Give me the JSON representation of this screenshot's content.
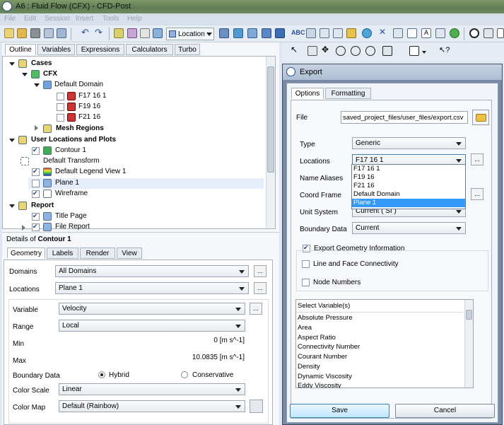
{
  "window": {
    "title": "A6 : Fluid Flow (CFX) - CFD-Post"
  },
  "menu": [
    "File",
    "Edit",
    "Session",
    "Insert",
    "Tools",
    "Help"
  ],
  "toolbar": {
    "location_label": "Location"
  },
  "left_tabs": [
    "Outline",
    "Variables",
    "Expressions",
    "Calculators",
    "Turbo"
  ],
  "tree": {
    "cases": "Cases",
    "cfx": "CFX",
    "default_domain": "Default Domain",
    "f17": "F17 16 1",
    "f19": "F19 16",
    "f21": "F21 16",
    "mesh_regions": "Mesh Regions",
    "user_locations": "User Locations and Plots",
    "contour1": "Contour 1",
    "default_transform": "Default Transform",
    "default_legend": "Default Legend View 1",
    "plane1": "Plane 1",
    "wireframe": "Wireframe",
    "report": "Report",
    "title_page": "Title Page",
    "file_report": "File Report"
  },
  "details": {
    "header_prefix": "Details of ",
    "header_obj": "Contour 1",
    "tabs": [
      "Geometry",
      "Labels",
      "Render",
      "View"
    ],
    "domains_label": "Domains",
    "domains_value": "All Domains",
    "locations_label": "Locations",
    "locations_value": "Plane 1",
    "variable_label": "Variable",
    "variable_value": "Velocity",
    "range_label": "Range",
    "range_value": "Local",
    "min_label": "Min",
    "min_value": "0 [m s^-1]",
    "max_label": "Max",
    "max_value": "10.0835 [m s^-1]",
    "boundary_label": "Boundary Data",
    "boundary_opt1": "Hybrid",
    "boundary_opt2": "Conservative",
    "color_scale_label": "Color Scale",
    "color_scale_value": "Linear",
    "color_map_label": "Color Map",
    "color_map_value": "Default (Rainbow)",
    "dots": "..."
  },
  "export": {
    "title": "Export",
    "tabs": [
      "Options",
      "Formatting"
    ],
    "file_label": "File",
    "file_value": "saved_project_files/user_files/export.csv",
    "type_label": "Type",
    "type_value": "Generic",
    "locations_label": "Locations",
    "locations_value": "F17 16 1",
    "locations_options": [
      "F17 16 1",
      "F19 16",
      "F21 16",
      "Default Domain",
      "Plane 1"
    ],
    "name_aliases_label": "Name Aliases",
    "coord_frame_label": "Coord Frame",
    "unit_system_label": "Unit System",
    "unit_system_value": "Current ( SI )",
    "boundary_label": "Boundary Data",
    "boundary_value": "Current",
    "export_geometry": "Export Geometry Information",
    "line_face": "Line and Face Connectivity",
    "node_numbers": "Node Numbers",
    "select_variables": "Select Variable(s)",
    "variables": [
      "Absolute Pressure",
      "Area",
      "Aspect Ratio",
      "Connectivity Number",
      "Courant Number",
      "Density",
      "Dynamic Viscosity",
      "Eddy Viscosity"
    ],
    "save": "Save",
    "cancel": "Cancel"
  },
  "colors": {
    "accent": "#3399ff",
    "title_bar": "#6f8a60"
  }
}
